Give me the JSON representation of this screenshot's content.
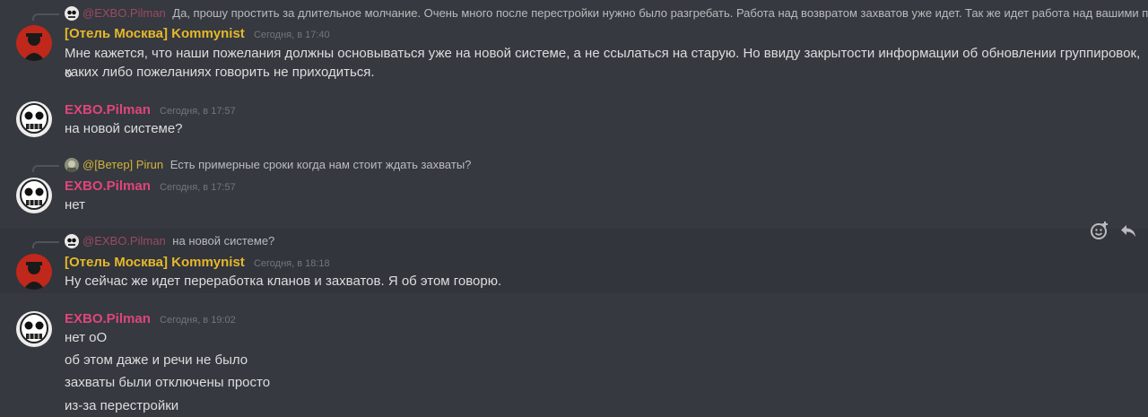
{
  "messages": [
    {
      "reply": {
        "name": "@EXBO.Pilman",
        "text": "Да, прошу простить за длительное молчание. Очень много после перестройки нужно было разгребать. Работа над возвратом захватов уже идет. Так же идет работа над вашими по..."
      },
      "author": "[Отель Москва] Kommynist",
      "time": "Сегодня, в 17:40",
      "lines": [
        "Мне кажется, что наши пожелания должны основываться уже на новой системе, а не ссылаться на старую. Но ввиду закрытости информации об обновлении группировок, о",
        "каких либо пожеланиях говорить не приходиться."
      ]
    },
    {
      "author": "EXBO.Pilman",
      "time": "Сегодня, в 17:57",
      "lines": [
        "на новой системе?"
      ]
    },
    {
      "reply": {
        "name": "@[Ветер] Pirun",
        "text": "Есть примерные сроки когда нам стоит ждать захваты?"
      },
      "author": "EXBO.Pilman",
      "time": "Сегодня, в 17:57",
      "lines": [
        "нет"
      ]
    },
    {
      "reply": {
        "name": "@EXBO.Pilman",
        "text": "на новой системе?"
      },
      "author": "[Отель Москва] Kommynist",
      "time": "Сегодня, в 18:18",
      "lines": [
        "Ну сейчас же идет переработка кланов и захватов. Я об этом говорю."
      ]
    },
    {
      "author": "EXBO.Pilman",
      "time": "Сегодня, в 19:02",
      "lines": [
        "нет оО",
        "об этом даже и речи не было",
        "захваты были отключены просто",
        "из-за перестройки"
      ]
    }
  ],
  "toolbar": {
    "icons": [
      "add-reaction-icon",
      "reply-icon"
    ]
  },
  "colors": {
    "background": "#36393f",
    "pilman": "#e0457b",
    "kommynist": "#e6b82a",
    "timestamp": "#72767d"
  }
}
